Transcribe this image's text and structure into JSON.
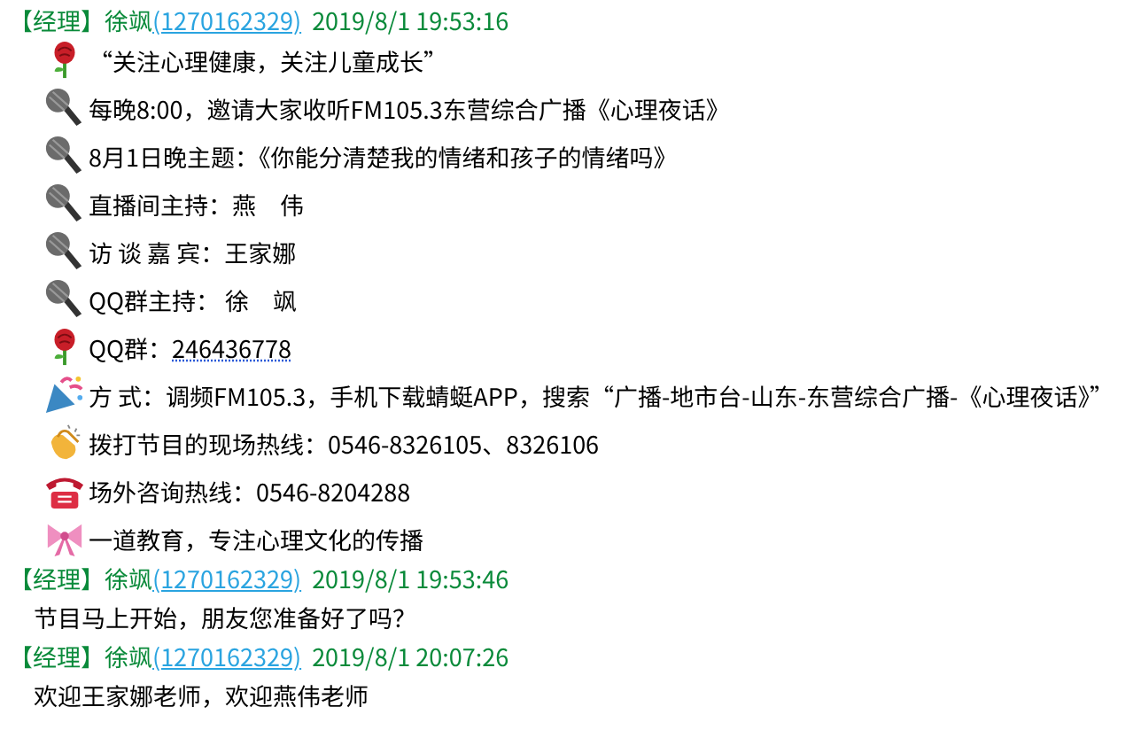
{
  "messages": [
    {
      "role": "【经理】",
      "name": "徐飒",
      "qq": "(1270162329)",
      "time": "2019/8/1 19:53:16",
      "lines": [
        {
          "kind": "rose",
          "text": "“关注心理健康，关注儿童成长”"
        },
        {
          "kind": "mic",
          "text": "每晚8:00，邀请大家收听FM105.3东营综合广播《心理夜话》"
        },
        {
          "kind": "mic",
          "text": "8月1日晚主题：《你能分清楚我的情绪和孩子的情绪吗》"
        },
        {
          "kind": "mic",
          "text": "直播间主持：燕　伟"
        },
        {
          "kind": "mic",
          "text": "访 谈 嘉 宾：王家娜"
        },
        {
          "kind": "mic",
          "text": "QQ群主持：  徐　飒"
        },
        {
          "kind": "rose",
          "text": "QQ群：",
          "link": "246436778"
        },
        {
          "kind": "party",
          "text": "方 式：调频FM105.3，手机下载蜻蜓APP，搜索“广播-地市台-山东-东营综合广播-《心理夜话》”"
        },
        {
          "kind": "clap",
          "text": "拨打节目的现场热线：0546-8326105、8326106"
        },
        {
          "kind": "phone",
          "text": "场外咨询热线：0546-8204288"
        },
        {
          "kind": "bow",
          "text": "一道教育，专注心理文化的传播"
        }
      ]
    },
    {
      "role": "【经理】",
      "name": "徐飒",
      "qq": "(1270162329)",
      "time": "2019/8/1 19:53:46",
      "lines": [
        {
          "kind": "plain",
          "text": "节目马上开始，朋友您准备好了吗？"
        }
      ]
    },
    {
      "role": "【经理】",
      "name": "徐飒",
      "qq": "(1270162329)",
      "time": "2019/8/1 20:07:26",
      "lines": [
        {
          "kind": "plain",
          "text": "欢迎王家娜老师，欢迎燕伟老师"
        }
      ]
    }
  ]
}
